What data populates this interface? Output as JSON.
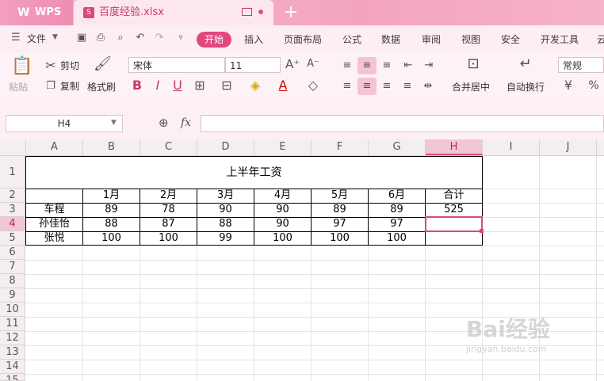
{
  "titlebar": {
    "app": "WPS",
    "doc_name": "百度经验.xlsx"
  },
  "menu": {
    "file": "文件",
    "items": [
      "开始",
      "插入",
      "页面布局",
      "公式",
      "数据",
      "审阅",
      "视图",
      "安全",
      "开发工具",
      "云"
    ]
  },
  "ribbon": {
    "paste": "粘贴",
    "cut": "剪切",
    "copy": "复制",
    "format_painter": "格式刷",
    "font_name": "宋体",
    "font_size": "11",
    "merge_center": "合并居中",
    "wrap_text": "自动换行",
    "number_format": "常规"
  },
  "formula_bar": {
    "name_box": "H4",
    "fx": "fx",
    "content": ""
  },
  "columns": [
    "A",
    "B",
    "C",
    "D",
    "E",
    "F",
    "G",
    "H",
    "I",
    "J"
  ],
  "rows": [
    "1",
    "2",
    "3",
    "4",
    "5",
    "6",
    "7",
    "8",
    "9",
    "10",
    "11",
    "12",
    "13",
    "14",
    "15"
  ],
  "sheet": {
    "title": "上半年工资",
    "headers": [
      "",
      "1月",
      "2月",
      "3月",
      "4月",
      "5月",
      "6月",
      "合计"
    ],
    "records": [
      {
        "name": "车程",
        "values": [
          "89",
          "78",
          "90",
          "90",
          "89",
          "89"
        ],
        "total": "525"
      },
      {
        "name": "孙佳怡",
        "values": [
          "88",
          "87",
          "88",
          "90",
          "97",
          "97"
        ],
        "total": ""
      },
      {
        "name": "张悦",
        "values": [
          "100",
          "100",
          "99",
          "100",
          "100",
          "100"
        ],
        "total": ""
      }
    ]
  },
  "watermark": {
    "brand": "Bai经验",
    "url": "jingyan.baidu.com"
  },
  "colors": {
    "accent": "#e0487e",
    "titlebar": "#f3a3c0",
    "selection": "#d9487e"
  }
}
